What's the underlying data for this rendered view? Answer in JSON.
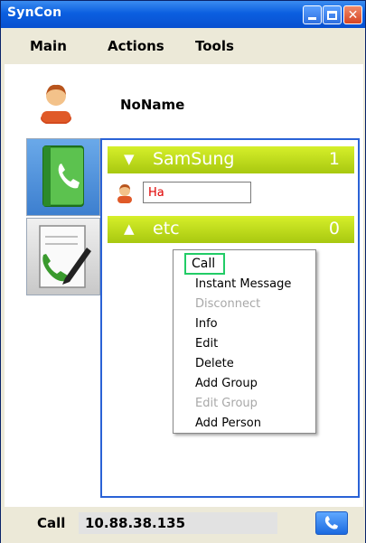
{
  "window": {
    "title": "SynCon"
  },
  "menu": {
    "items": [
      "Main",
      "Actions",
      "Tools"
    ]
  },
  "profile": {
    "name": "NoName"
  },
  "groups": [
    {
      "name": "SamSung",
      "count": "1",
      "expanded": true
    },
    {
      "name": "etc",
      "count": "0",
      "expanded": false
    }
  ],
  "contacts": [
    {
      "name": "Ha"
    }
  ],
  "context_menu": {
    "items": [
      {
        "label": "Call",
        "enabled": true,
        "highlighted": true
      },
      {
        "label": "Instant Message",
        "enabled": true
      },
      {
        "label": "Disconnect",
        "enabled": false
      },
      {
        "label": "Info",
        "enabled": true
      },
      {
        "label": "Edit",
        "enabled": true
      },
      {
        "label": "Delete",
        "enabled": true
      },
      {
        "label": "Add Group",
        "enabled": true
      },
      {
        "label": "Edit Group",
        "enabled": false
      },
      {
        "label": "Add Person",
        "enabled": true
      }
    ]
  },
  "callbar": {
    "label": "Call",
    "address": "10.88.38.135"
  },
  "colors": {
    "titlebar": "#0b5fe0",
    "group_header": "#b8d818",
    "panel_border": "#2a62d6",
    "highlight": "#22cc66"
  },
  "icons": {
    "titlebar": [
      "minimize-icon",
      "maximize-icon",
      "close-icon"
    ],
    "side": [
      "contacts-book-icon",
      "call-log-icon"
    ],
    "call_button": "phone-icon"
  }
}
